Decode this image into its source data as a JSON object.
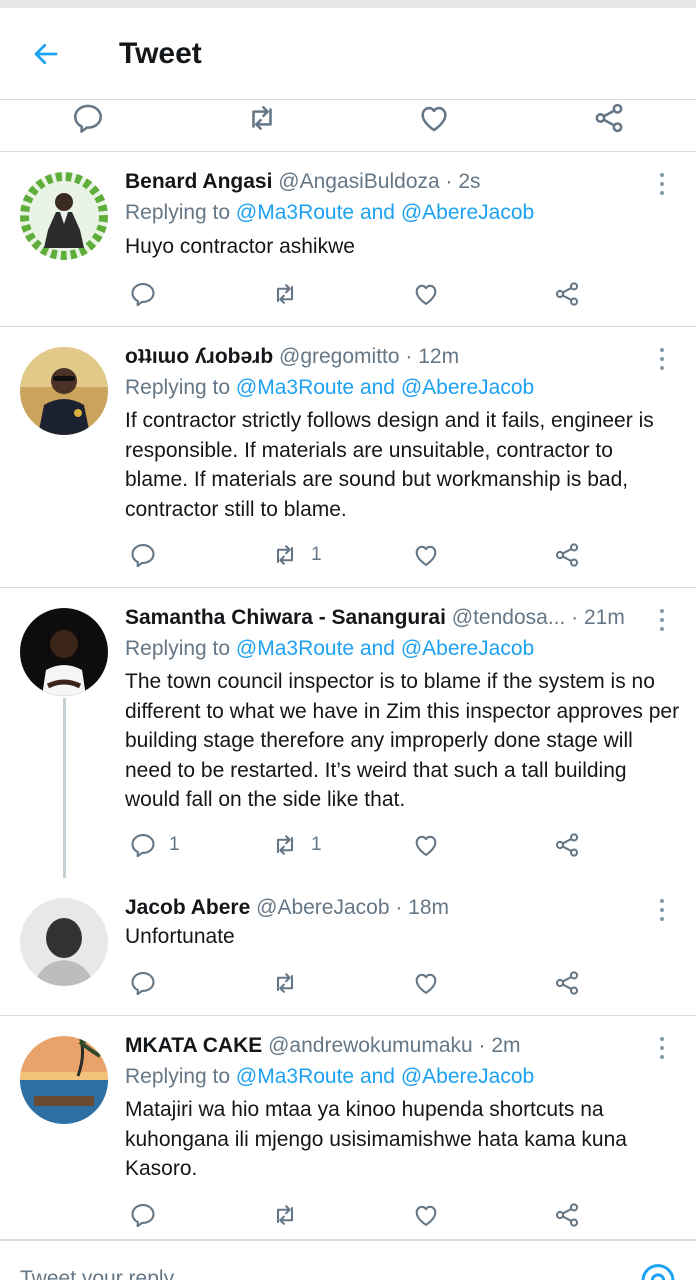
{
  "header": {
    "title": "Tweet"
  },
  "tweets": [
    {
      "name": "Benard Angasi",
      "meta": "@AngasiBuldoza · 2s",
      "replying_prefix": "Replying to",
      "replying_links": "@Ma3Route and @AbereJacob",
      "text": "Huyo contractor ashikwe",
      "reply_count": "",
      "retweet_count": ""
    },
    {
      "name": "oʇʇıɯo ʎɹobǝɹb",
      "meta": "@gregomitto · 12m",
      "replying_prefix": "Replying to",
      "replying_links": "@Ma3Route and @AbereJacob",
      "text": "If contractor strictly follows design and it fails, engineer is responsible. If materials are unsuitable, contractor to blame. If materials are sound but workmanship is bad, contractor still to blame.",
      "reply_count": "",
      "retweet_count": "1"
    },
    {
      "name": "Samantha Chiwara - Sanangurai",
      "meta": "@tendosa... · 21m",
      "replying_prefix": "Replying to",
      "replying_links": "@Ma3Route and @AbereJacob",
      "text": "The town council inspector is to blame if the system is no different to what we have in Zim this inspector approves per building stage therefore any improperly done stage will need to be restarted. It’s weird that such a tall building would fall on the side like that.",
      "reply_count": "1",
      "retweet_count": "1"
    },
    {
      "name": "Jacob Abere",
      "meta": "@AbereJacob · 18m",
      "text": "Unfortunate",
      "reply_count": "",
      "retweet_count": ""
    },
    {
      "name": "MKATA CAKE",
      "meta": "@andrewokumumaku · 2m",
      "replying_prefix": "Replying to",
      "replying_links": "@Ma3Route and @AbereJacob",
      "text": "Matajiri wa hio mtaa ya kinoo hupenda shortcuts na kuhongana ili mjengo usisimamishwe hata kama kuna Kasoro.",
      "reply_count": "",
      "retweet_count": ""
    }
  ],
  "compose": {
    "placeholder": "Tweet your reply"
  },
  "colors": {
    "accent": "#1da1f2",
    "icon": "#657786",
    "divider": "#d8dde1"
  }
}
